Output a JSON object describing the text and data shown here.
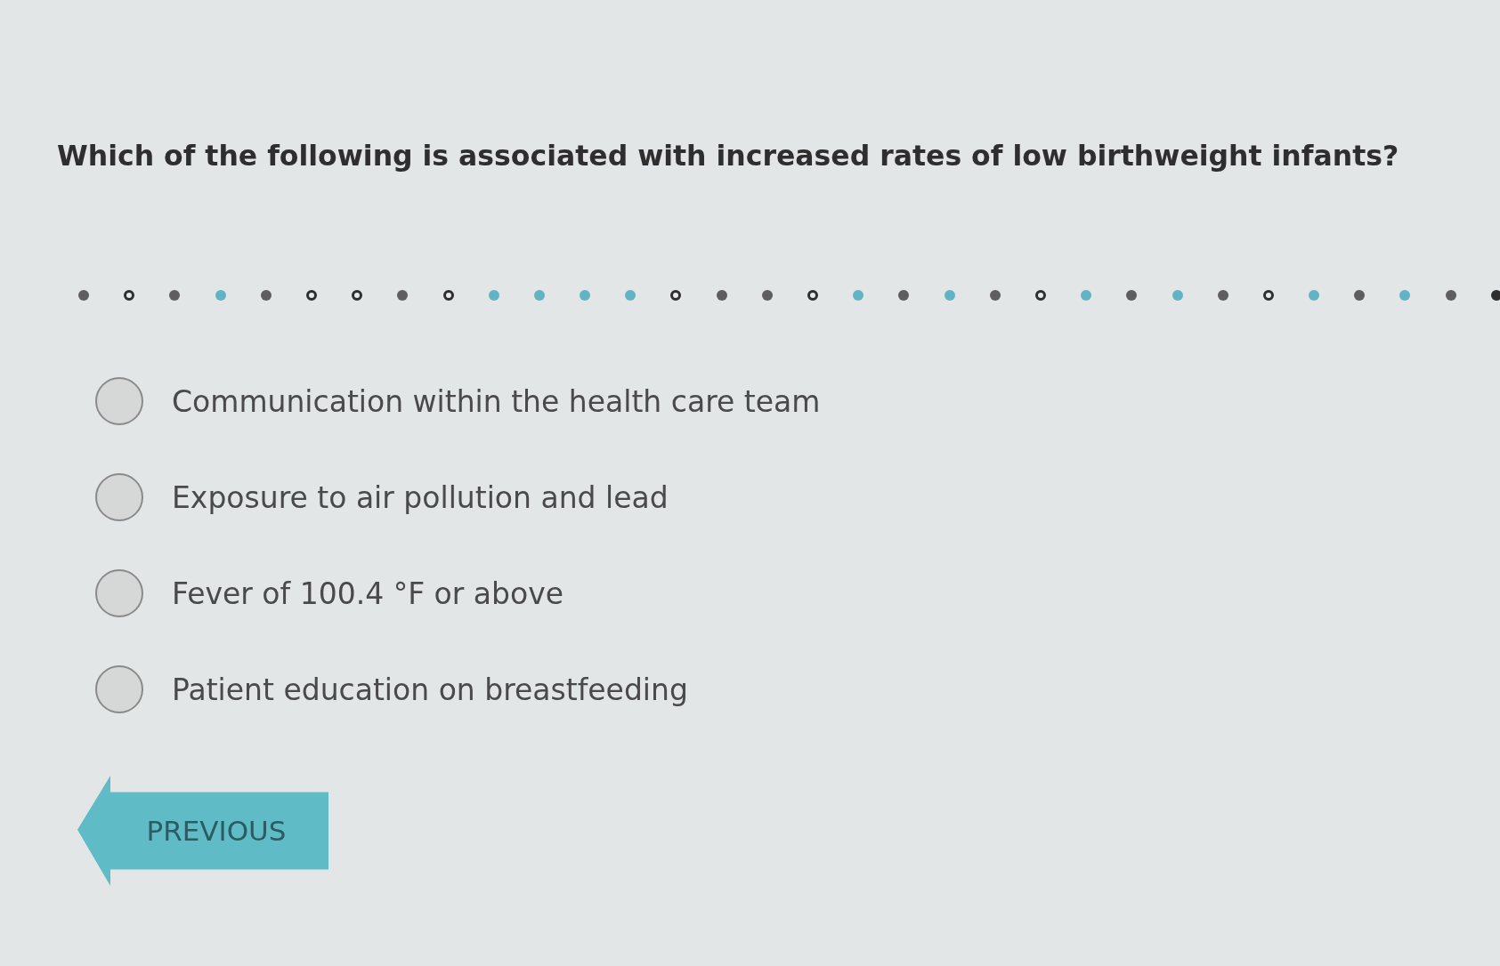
{
  "question": "Which of the following is associated with increased rates of low birthweight infants?",
  "progress_dots": [
    {
      "kind": "solid",
      "color": "#5e5e5e"
    },
    {
      "kind": "ring",
      "color": "#2e2e2e"
    },
    {
      "kind": "solid",
      "color": "#5e5e5e"
    },
    {
      "kind": "solid",
      "color": "#62b3c4"
    },
    {
      "kind": "solid",
      "color": "#5e5e5e"
    },
    {
      "kind": "ring",
      "color": "#2e2e2e"
    },
    {
      "kind": "ring",
      "color": "#2e2e2e"
    },
    {
      "kind": "solid",
      "color": "#5e5e5e"
    },
    {
      "kind": "ring",
      "color": "#2e2e2e"
    },
    {
      "kind": "solid",
      "color": "#62b3c4"
    },
    {
      "kind": "solid",
      "color": "#62b3c4"
    },
    {
      "kind": "solid",
      "color": "#62b3c4"
    },
    {
      "kind": "solid",
      "color": "#62b3c4"
    },
    {
      "kind": "ring",
      "color": "#2e2e2e"
    },
    {
      "kind": "solid",
      "color": "#5e5e5e"
    },
    {
      "kind": "solid",
      "color": "#5e5e5e"
    },
    {
      "kind": "ring",
      "color": "#2e2e2e"
    },
    {
      "kind": "solid",
      "color": "#62b3c4"
    },
    {
      "kind": "solid",
      "color": "#5e5e5e"
    },
    {
      "kind": "solid",
      "color": "#62b3c4"
    },
    {
      "kind": "solid",
      "color": "#5e5e5e"
    },
    {
      "kind": "ring",
      "color": "#2e2e2e"
    },
    {
      "kind": "solid",
      "color": "#62b3c4"
    },
    {
      "kind": "solid",
      "color": "#5e5e5e"
    },
    {
      "kind": "solid",
      "color": "#62b3c4"
    },
    {
      "kind": "solid",
      "color": "#5e5e5e"
    },
    {
      "kind": "ring",
      "color": "#2e2e2e"
    },
    {
      "kind": "solid",
      "color": "#62b3c4"
    },
    {
      "kind": "solid",
      "color": "#5e5e5e"
    },
    {
      "kind": "solid",
      "color": "#62b3c4"
    },
    {
      "kind": "solid",
      "color": "#5e5e5e"
    },
    {
      "kind": "solid",
      "color": "#2e2e2e"
    }
  ],
  "options": [
    {
      "label": "Communication within the health care team",
      "selected": false
    },
    {
      "label": "Exposure to air pollution and lead",
      "selected": false
    },
    {
      "label": "Fever of 100.4 °F or above",
      "selected": false
    },
    {
      "label": "Patient education on breastfeeding",
      "selected": false
    }
  ],
  "previous_button": {
    "label": "PREVIOUS"
  }
}
